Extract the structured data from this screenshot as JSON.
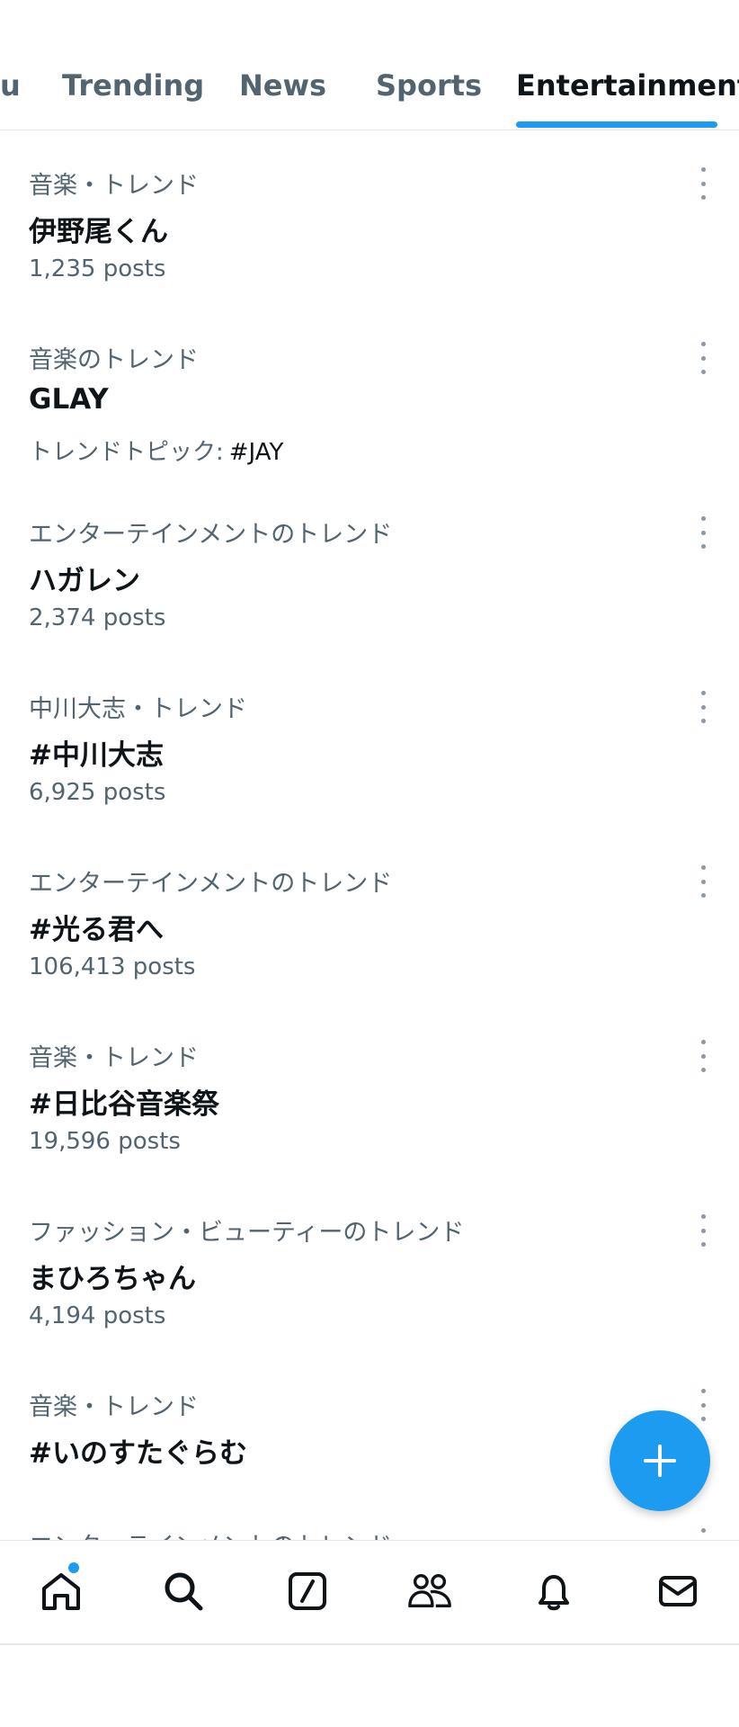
{
  "tabs": [
    {
      "label": "u",
      "active": false
    },
    {
      "label": "Trending",
      "active": false
    },
    {
      "label": "News",
      "active": false
    },
    {
      "label": "Sports",
      "active": false
    },
    {
      "label": "Entertainment",
      "active": true
    }
  ],
  "trends": [
    {
      "category": "音楽・トレンド",
      "name": "伊野尾くん",
      "posts": "1,235 posts"
    },
    {
      "category": "音楽のトレンド",
      "name": "GLAY",
      "topic_label": "トレンドトピック:",
      "topic_tag": "#JAY"
    },
    {
      "category": "エンターテインメントのトレンド",
      "name": "ハガレン",
      "posts": "2,374 posts"
    },
    {
      "category": "中川大志・トレンド",
      "name": "#中川大志",
      "posts": "6,925 posts"
    },
    {
      "category": "エンターテインメントのトレンド",
      "name": "#光る君へ",
      "posts": "106,413 posts"
    },
    {
      "category": "音楽・トレンド",
      "name": "#日比谷音楽祭",
      "posts": "19,596 posts"
    },
    {
      "category": "ファッション・ビューティーのトレンド",
      "name": "まひろちゃん",
      "posts": "4,194 posts"
    },
    {
      "category": "音楽・トレンド",
      "name": "#いのすたぐらむ"
    },
    {
      "category": "エンターテインメントのトレンド"
    }
  ],
  "fab": {
    "icon": "plus-icon",
    "color": "#1d9bf0"
  },
  "bottom_nav": {
    "items": [
      "home-icon",
      "search-icon",
      "grok-icon",
      "communities-icon",
      "notifications-icon",
      "messages-icon"
    ],
    "home_has_unread_dot": true
  },
  "colors": {
    "accent": "#1d9bf0",
    "text": "#0f1419",
    "secondary": "#536471",
    "divider": "#e6e9ec"
  }
}
